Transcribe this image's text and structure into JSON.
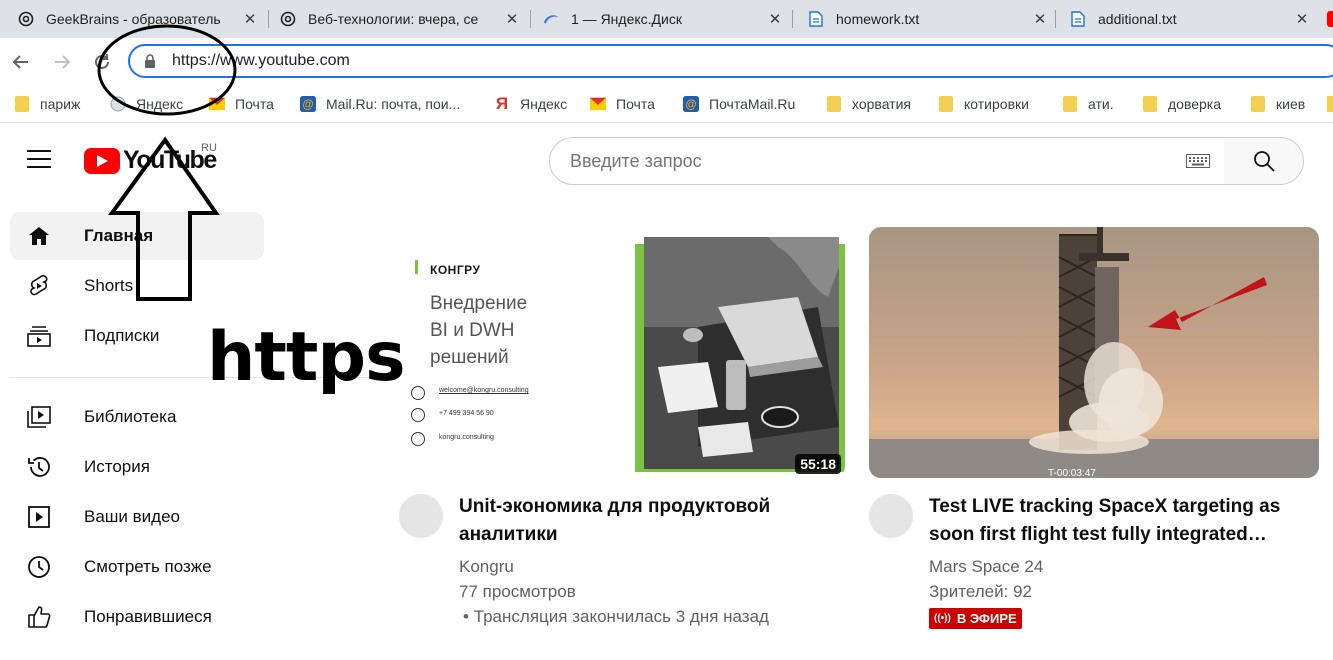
{
  "browser": {
    "tabs": [
      {
        "title": "GeekBrains - образователь",
        "icon": "openai-like-icon"
      },
      {
        "title": "Веб-технологии: вчера, се",
        "icon": "openai-like-icon"
      },
      {
        "title": "1 — Яндекс.Диск",
        "icon": "yandex-disk-icon"
      },
      {
        "title": "homework.txt",
        "icon": "document-icon"
      },
      {
        "title": "additional.txt",
        "icon": "document-icon"
      }
    ],
    "address": {
      "url": "https://www.youtube.com"
    },
    "bookmarks": [
      {
        "label": "париж",
        "icon": "folder-icon"
      },
      {
        "label": "Яндекс",
        "icon": "yandex-icon"
      },
      {
        "label": "Почта",
        "icon": "mail-icon"
      },
      {
        "label": "Mail.Ru: почта, пои...",
        "icon": "mailru-icon"
      },
      {
        "label": "Яндекс",
        "icon": "yandex-y-icon"
      },
      {
        "label": "Почта",
        "icon": "mail-icon"
      },
      {
        "label": "ПочтаMail.Ru",
        "icon": "mailru-icon"
      },
      {
        "label": "хорватия",
        "icon": "folder-icon"
      },
      {
        "label": "котировки",
        "icon": "folder-icon"
      },
      {
        "label": "ати.",
        "icon": "folder-icon"
      },
      {
        "label": "доверка",
        "icon": "folder-icon"
      },
      {
        "label": "киев",
        "icon": "folder-icon"
      }
    ]
  },
  "youtube": {
    "logo_text": "YouTube",
    "region": "RU",
    "search_placeholder": "Введите запрос",
    "sidebar": [
      {
        "label": "Главная",
        "icon": "home-icon",
        "active": true
      },
      {
        "label": "Shorts",
        "icon": "shorts-icon"
      },
      {
        "label": "Подписки",
        "icon": "subscriptions-icon"
      },
      {
        "label": "Библиотека",
        "icon": "library-icon"
      },
      {
        "label": "История",
        "icon": "history-icon"
      },
      {
        "label": "Ваши видео",
        "icon": "your-videos-icon"
      },
      {
        "label": "Смотреть позже",
        "icon": "watch-later-icon"
      },
      {
        "label": "Понравившиеся",
        "icon": "liked-icon"
      }
    ],
    "videos": [
      {
        "title_line1": "Unit-экономика для продуктовой",
        "title_line2": "аналитики",
        "channel": "Kongru",
        "views": "77 просмотров",
        "time": "• Трансляция закончилась 3 дня назад",
        "duration": "55:18",
        "thumb": {
          "brand": "КОНГРУ",
          "headline1": "Внедрение",
          "headline2": "BI и DWH",
          "headline3": "решений",
          "email": "welcome@kongru.consulting",
          "phone": "+7 499 394 56 90",
          "site": "kongru.consulting"
        }
      },
      {
        "title_line1": "Test LIVE tracking SpaceX targeting as",
        "title_line2": "soon first flight test fully integrated…",
        "channel": "Mars Space 24",
        "viewers": "Зрителей: 92",
        "live": "В ЭФИРЕ",
        "countdown": "T-00:03:47"
      }
    ]
  },
  "annotation": {
    "text": "https"
  },
  "colors": {
    "accent": "#1a73e8",
    "yt_red": "#ff0000",
    "live_red": "#cc0000",
    "arrow_red": "#c0141a",
    "kongru_green": "#7cc242"
  }
}
